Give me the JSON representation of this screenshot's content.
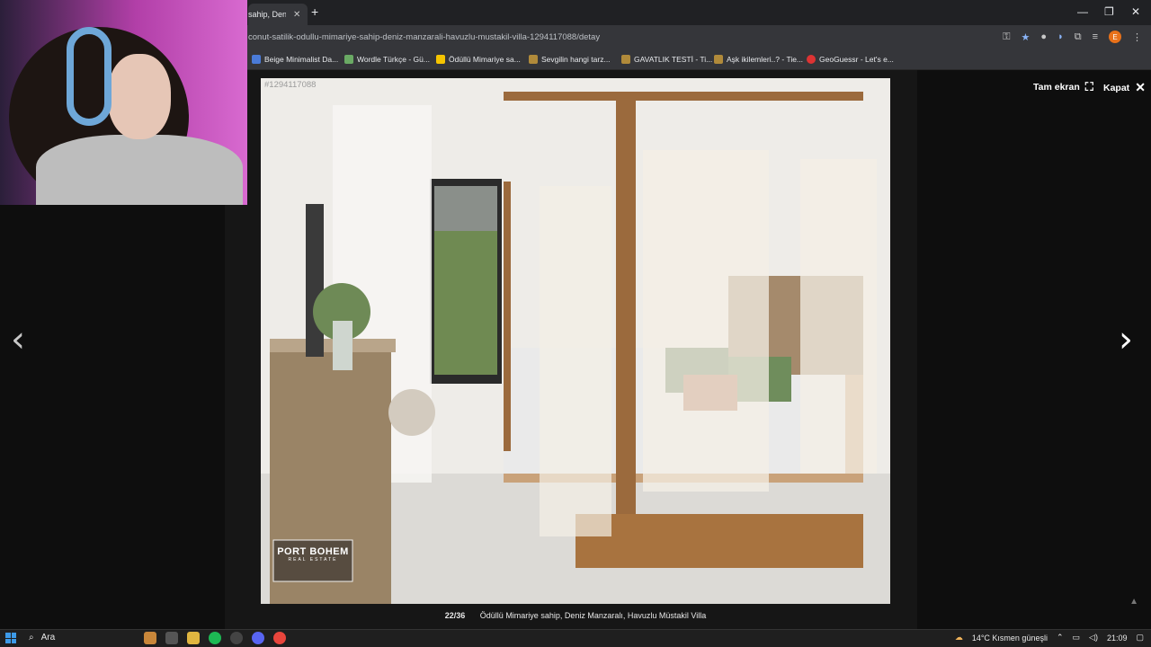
{
  "browser": {
    "tab_title": "sahip, Deniz M",
    "new_tab": "+",
    "url": "conut-satilik-odullu-mimariye-sahip-deniz-manzarali-havuzlu-mustakil-villa-1294117088/detay",
    "profile_initial": "E",
    "bookmarks": [
      {
        "label": "Beige Minimalist Da...",
        "color": "#4a7bd8"
      },
      {
        "label": "Wordle Türkçe - Gü...",
        "color": "#6aaa64"
      },
      {
        "label": "Ödüllü Mimariye sa...",
        "color": "#f5c400"
      },
      {
        "label": "Sevgilin hangi tarz...",
        "color": "#b08a3a"
      },
      {
        "label": "GAVATLIK TESTİ - Ti...",
        "color": "#b08a3a"
      },
      {
        "label": "Aşk ikilemleri..? - Tie...",
        "color": "#b08a3a"
      },
      {
        "label": "GeoGuessr - Let's e...",
        "color": "#d33"
      }
    ]
  },
  "lightbox": {
    "photo_id": "#1294117088",
    "fullscreen_label": "Tam ekran",
    "close_label": "Kapat",
    "counter": "22/36",
    "caption": "Ödüllü Mimariye sahip, Deniz Manzaralı, Havuzlu Müstakil Villa",
    "watermark_main": "PORT BOHEM",
    "watermark_sub": "REAL ESTATE"
  },
  "taskbar": {
    "search_label": "Ara",
    "weather": "14°C Kısmen güneşli",
    "time": "21:09"
  },
  "icons": {
    "prev": "chevron-left-icon",
    "next": "chevron-right-icon"
  }
}
